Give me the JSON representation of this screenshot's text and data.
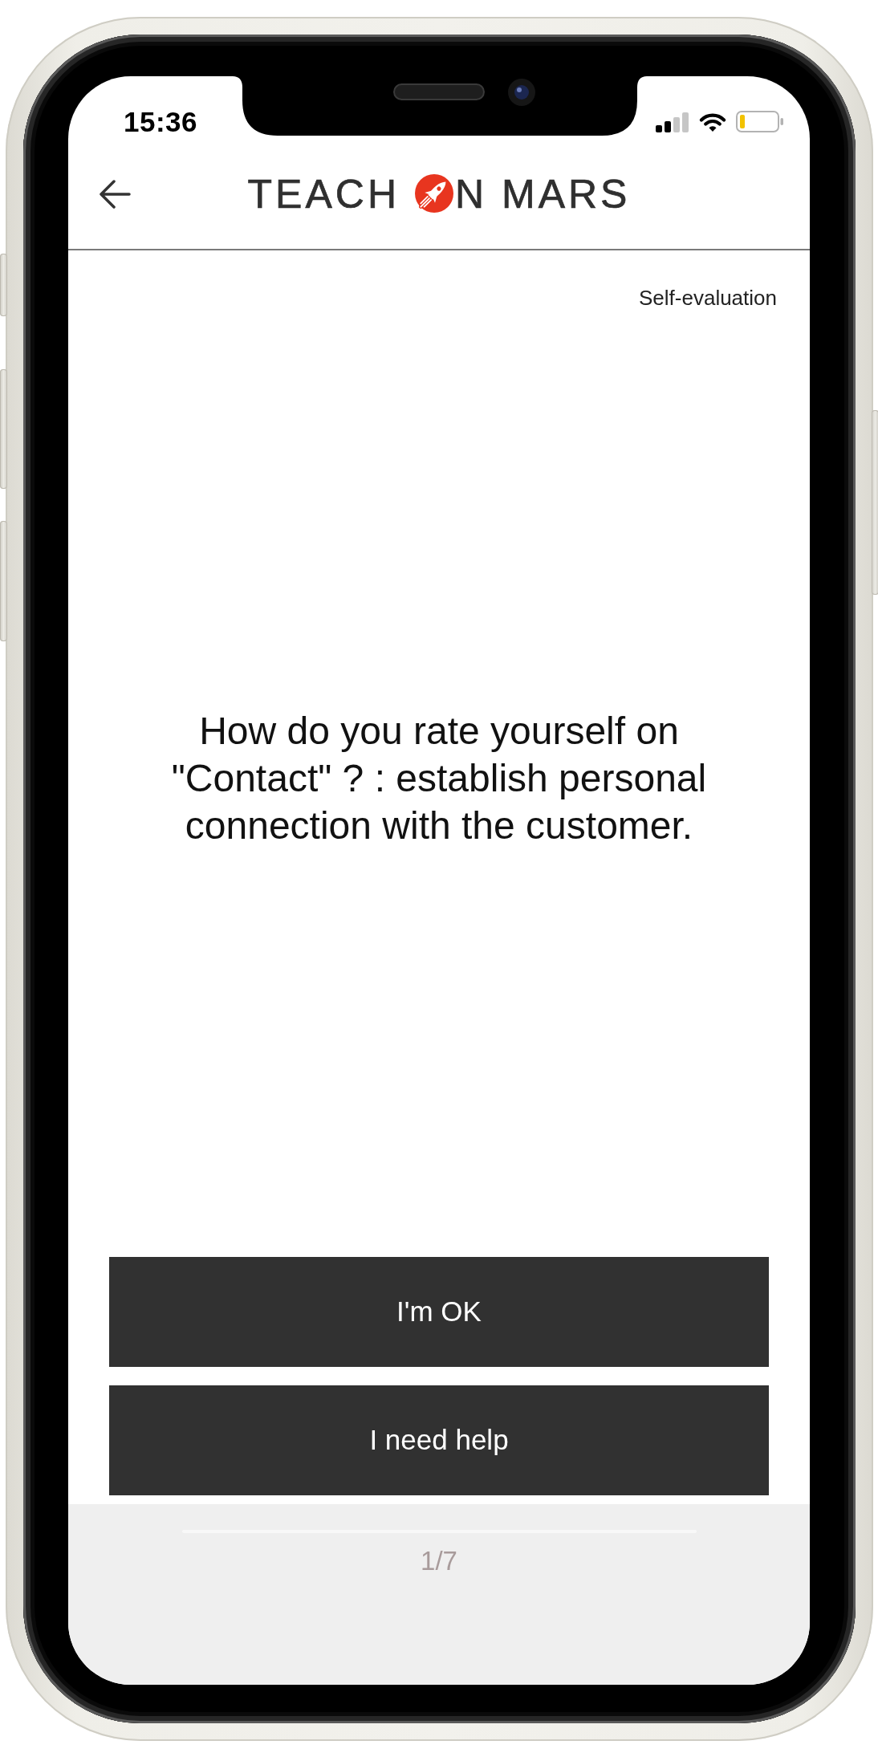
{
  "status_bar": {
    "time": "15:36"
  },
  "header": {
    "logo": {
      "text_before": "TEACH",
      "text_after": "N MARS"
    }
  },
  "activity_label": "Self-evaluation",
  "question": "How do you rate yourself on \"Contact\" ? : establish personal connection with the customer.",
  "answers": [
    {
      "label": "I'm OK"
    },
    {
      "label": "I need help"
    }
  ],
  "footer": {
    "progress": "1/7"
  }
}
